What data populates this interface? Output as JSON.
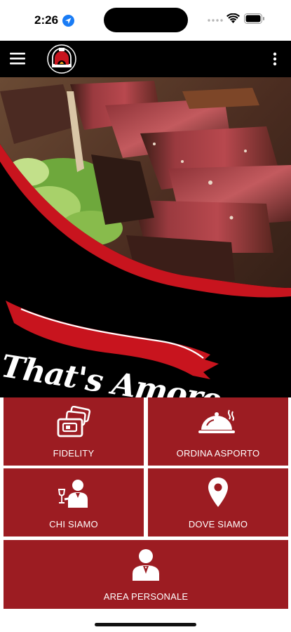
{
  "status_bar": {
    "time": "2:26"
  },
  "app_bar": {
    "menu_icon": "hamburger-menu-icon",
    "logo_icon": "pizza-oven-logo-icon",
    "more_icon": "vertical-dots-icon"
  },
  "hero": {
    "brand_text": "That's Amore",
    "image": "grilled-steak-photo",
    "accent_color": "#c8141e"
  },
  "menu": {
    "fidelity": {
      "label": "FIDELITY",
      "icon": "loyalty-cards-icon"
    },
    "order": {
      "label": "ORDINA ASPORTO",
      "icon": "cloche-icon"
    },
    "about": {
      "label": "CHI SIAMO",
      "icon": "waiter-icon"
    },
    "where": {
      "label": "DOVE SIAMO",
      "icon": "map-pin-icon"
    },
    "personal": {
      "label": "AREA PERSONALE",
      "icon": "person-icon"
    }
  },
  "colors": {
    "tile_bg": "#9c1c22",
    "app_bar_bg": "#000000",
    "text": "#ffffff"
  }
}
